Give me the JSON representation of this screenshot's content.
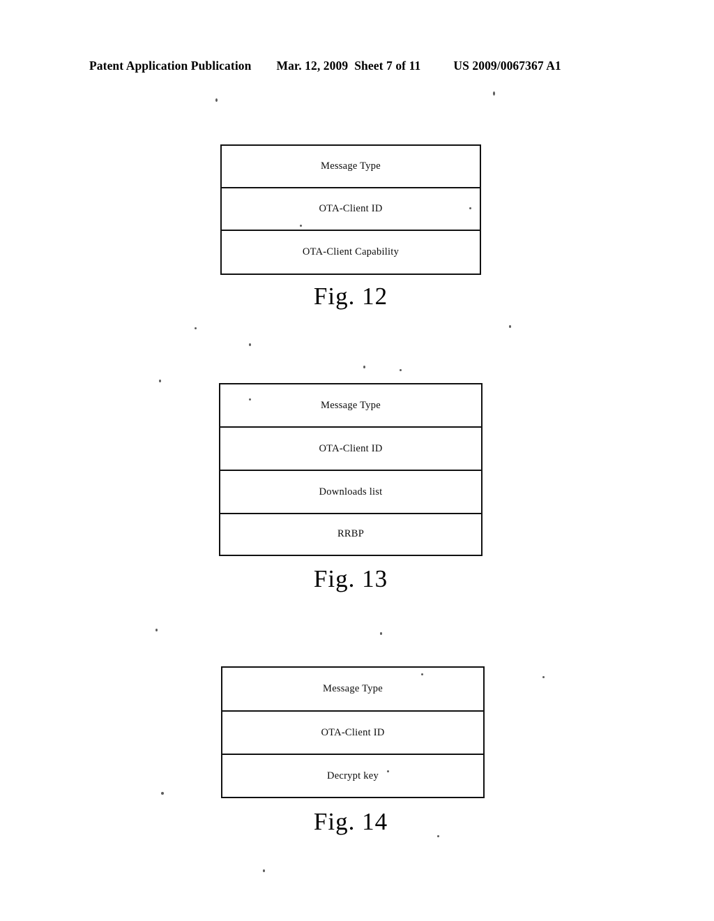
{
  "header": {
    "publication": "Patent Application Publication",
    "date": "Mar. 12, 2009",
    "sheet": "Sheet 7 of 11",
    "patent_number": "US 2009/0067367 A1"
  },
  "figures": [
    {
      "caption": "Fig. 12",
      "rows": [
        {
          "label": "Message Type"
        },
        {
          "label": "OTA-Client ID"
        },
        {
          "label": "OTA-Client Capability"
        }
      ]
    },
    {
      "caption": "Fig. 13",
      "rows": [
        {
          "label": "Message Type"
        },
        {
          "label": "OTA-Client ID"
        },
        {
          "label": "Downloads list"
        },
        {
          "label": "RRBP"
        }
      ]
    },
    {
      "caption": "Fig. 14",
      "rows": [
        {
          "label": "Message Type"
        },
        {
          "label": "OTA-Client ID"
        },
        {
          "label": "Decrypt key"
        }
      ]
    }
  ]
}
